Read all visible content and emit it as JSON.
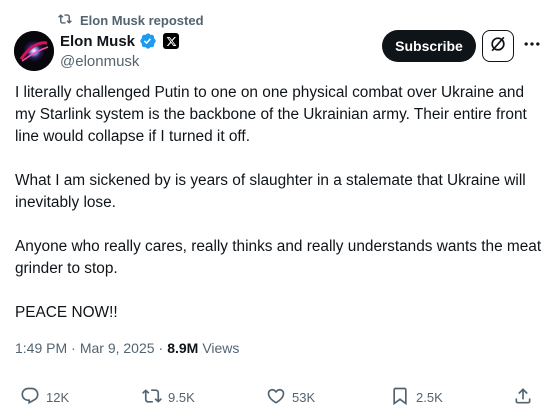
{
  "repost": {
    "label": "Elon Musk reposted"
  },
  "author": {
    "name": "Elon Musk",
    "handle": "@elonmusk"
  },
  "header": {
    "subscribe_label": "Subscribe"
  },
  "icons": {
    "repost": "repost-icon",
    "verified": "verified-badge-icon",
    "affiliation": "x-logo-icon",
    "grok": "grok-icon",
    "more": "more-icon",
    "reply": "reply-icon",
    "like": "heart-icon",
    "bookmark": "bookmark-icon",
    "share": "share-icon"
  },
  "colors": {
    "verified": "#1d9bf0",
    "text_secondary": "#536471",
    "text_primary": "#0f1419"
  },
  "post": {
    "paragraphs": [
      "I literally challenged Putin to one on one physical combat over Ukraine and my Starlink system is the backbone of the Ukrainian army. Their entire front line would collapse if I turned it off.",
      "What I am sickened by is years of slaughter in a stalemate that Ukraine will inevitably lose.",
      "Anyone who really cares, really thinks and really understands wants the meat grinder to stop.",
      "PEACE NOW!!"
    ],
    "time": "1:49 PM",
    "date": "Mar 9, 2025",
    "views_count": "8.9M",
    "views_label": "Views"
  },
  "stats": {
    "replies": "12K",
    "reposts": "9.5K",
    "likes": "53K",
    "bookmarks": "2.5K"
  }
}
